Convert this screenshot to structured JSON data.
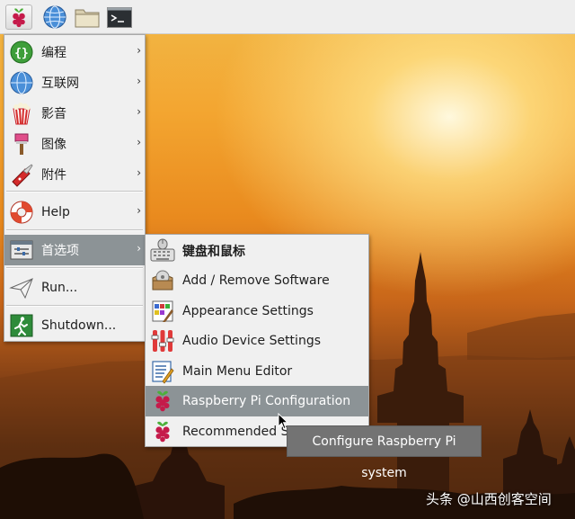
{
  "panel": {
    "buttons": [
      {
        "name": "applications-menu-button",
        "icon": "raspberry-icon"
      },
      {
        "name": "browser-button",
        "icon": "globe-icon"
      },
      {
        "name": "file-manager-button",
        "icon": "folder-icon"
      },
      {
        "name": "terminal-button",
        "icon": "terminal-icon"
      }
    ]
  },
  "main_menu": {
    "items": [
      {
        "label": "编程",
        "icon": "programming-icon",
        "has_submenu": true
      },
      {
        "label": "互联网",
        "icon": "globe-icon",
        "has_submenu": true
      },
      {
        "label": "影音",
        "icon": "popcorn-icon",
        "has_submenu": true
      },
      {
        "label": "图像",
        "icon": "paint-brush-icon",
        "has_submenu": true
      },
      {
        "label": "附件",
        "icon": "pocket-knife-icon",
        "has_submenu": true
      },
      {
        "label": "Help",
        "icon": "lifebuoy-icon",
        "has_submenu": true
      },
      {
        "label": "首选项",
        "icon": "preferences-icon",
        "has_submenu": true,
        "highlighted": true
      },
      {
        "label": "Run...",
        "icon": "paper-plane-icon",
        "has_submenu": false
      },
      {
        "label": "Shutdown...",
        "icon": "exit-icon",
        "has_submenu": false
      }
    ]
  },
  "preferences_menu": {
    "items": [
      {
        "label": "键盘和鼠标",
        "icon": "keyboard-mouse-icon"
      },
      {
        "label": "Add / Remove Software",
        "icon": "package-icon"
      },
      {
        "label": "Appearance Settings",
        "icon": "appearance-icon"
      },
      {
        "label": "Audio Device Settings",
        "icon": "audio-sliders-icon"
      },
      {
        "label": "Main Menu Editor",
        "icon": "menu-editor-icon"
      },
      {
        "label": "Raspberry Pi Configuration",
        "icon": "raspberry-icon",
        "highlighted": true
      },
      {
        "label": "Recommended So",
        "icon": "raspberry-icon"
      }
    ]
  },
  "tooltip": {
    "text": "Configure Raspberry Pi system"
  },
  "watermark": {
    "text": "头条 @山西创客空间"
  },
  "arrow_glyph": "›",
  "colors": {
    "highlight": "#8c9396",
    "menu_bg": "#f0f0f0",
    "tooltip_bg": "#737373"
  }
}
